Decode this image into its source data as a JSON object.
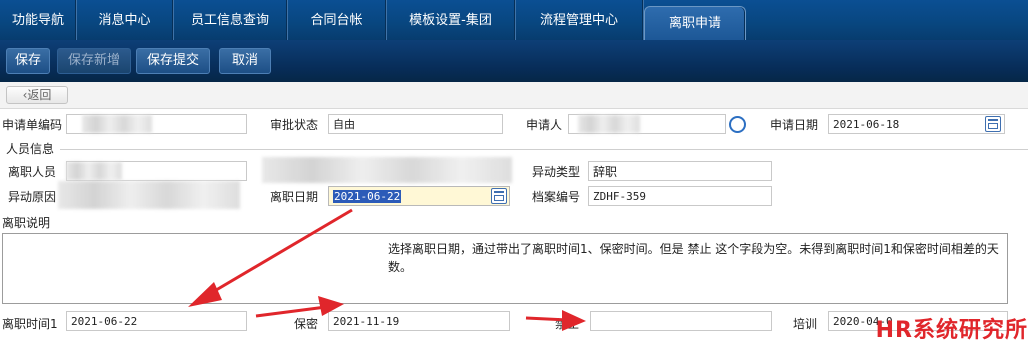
{
  "tabs": [
    {
      "label": "功能导航"
    },
    {
      "label": "消息中心"
    },
    {
      "label": "员工信息查询"
    },
    {
      "label": "合同台帐"
    },
    {
      "label": "模板设置-集团"
    },
    {
      "label": "流程管理中心"
    },
    {
      "label": "离职申请",
      "active": true
    }
  ],
  "toolbar": {
    "save": "保存",
    "save_new": "保存新增",
    "save_submit": "保存提交",
    "cancel": "取消"
  },
  "back": "返回",
  "form": {
    "app_code_label": "申请单编码",
    "approval_status_label": "审批状态",
    "approval_status_value": "自由",
    "applicant_label": "申请人",
    "apply_date_label": "申请日期",
    "apply_date_value": "2021-06-18",
    "personnel_section": "人员信息",
    "leaver_label": "离职人员",
    "change_type_label": "异动类型",
    "change_type_value": "辞职",
    "change_reason_label": "异动原因",
    "leave_date_label": "离职日期",
    "leave_date_value": "2021-06-22",
    "archive_no_label": "档案编号",
    "archive_no_value": "ZDHF-359",
    "leave_desc_label": "离职说明",
    "note": "选择离职日期，通过带出了离职时间1、保密时间。但是 禁止 这个字段为空。未得到离职时间1和保密时间相差的天数。",
    "leave_time1_label": "离职时间1",
    "leave_time1_value": "2021-06-22",
    "confidential_label": "保密",
    "confidential_value": "2021-11-19",
    "prohibit_label": "禁止",
    "prohibit_value": "",
    "training_label": "培训",
    "training_value": "2020-04-0"
  },
  "watermark": "HR系统研究所",
  "colors": {
    "tab_bar": "#08467f",
    "toolbar": "#072c57",
    "annotation_arrow": "#e0262b",
    "selected_field": "#fff8d6"
  },
  "icons": {
    "back": "chevron-left-icon",
    "calendar": "calendar-icon",
    "lookup": "chat-bubble-icon"
  }
}
